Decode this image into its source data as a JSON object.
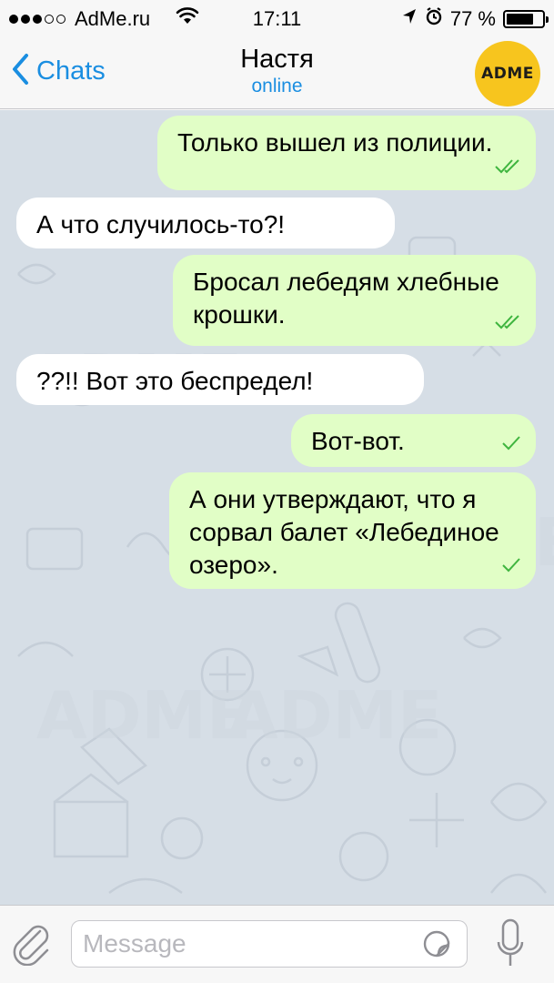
{
  "status_bar": {
    "carrier": "AdMe.ru",
    "time": "17:11",
    "battery": "77 %",
    "battery_level": 0.77,
    "signal_bars": 3,
    "signal_total": 5
  },
  "header": {
    "back_label": "Chats",
    "contact_name": "Настя",
    "contact_status": "online",
    "avatar_text": "ADME",
    "avatar_color": "#f7c51e"
  },
  "messages": [
    {
      "direction": "out",
      "text": "Только вышел из полиции.",
      "status": "read"
    },
    {
      "direction": "in",
      "text": "А что случилось-то?!"
    },
    {
      "direction": "out",
      "text": "Бросал лебедям хлебные крошки.",
      "status": "read"
    },
    {
      "direction": "in",
      "text": "??!! Вот это беспредел!"
    },
    {
      "direction": "out",
      "text": "Вот-вот.",
      "status": "delivered"
    },
    {
      "direction": "out",
      "text": "А они утверждают, что я сорвал балет «Лебединое озеро».",
      "status": "delivered"
    }
  ],
  "input": {
    "placeholder": "Message",
    "value": ""
  },
  "colors": {
    "accent": "#1a8ee1",
    "outgoing_bubble": "#e1fec6",
    "incoming_bubble": "#ffffff",
    "check": "#3fb53f",
    "chat_background": "#d6dee6"
  }
}
